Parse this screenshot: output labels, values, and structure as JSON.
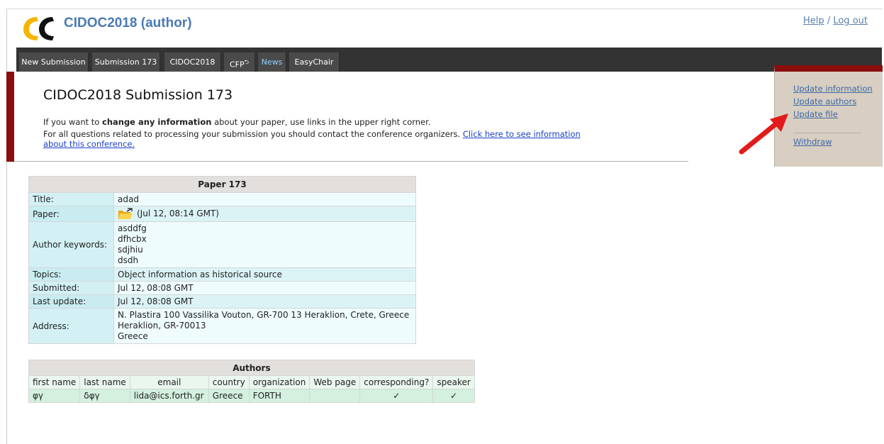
{
  "header": {
    "app_title": "CIDOC2018 (author)",
    "help_link": "Help",
    "separator": "/",
    "logout_link": "Log out"
  },
  "nav": {
    "tabs": [
      "New Submission",
      "Submission 173",
      "CIDOC2018",
      "CFP",
      "News",
      "EasyChair"
    ]
  },
  "main": {
    "heading": "CIDOC2018 Submission 173",
    "info1_pre": "If you want to ",
    "info1_bold": "change any information",
    "info1_post": " about your paper, use links in the upper right corner.",
    "info2_pre": "For all questions related to processing your submission you should contact the conference organizers. ",
    "info2_link_line1": "Click here to see information",
    "info2_link_line2": "about this conference."
  },
  "side_panel": {
    "update_information": "Update information",
    "update_authors": "Update authors",
    "update_file": "Update file",
    "withdraw": "Withdraw"
  },
  "paper": {
    "caption": "Paper 173",
    "rows": {
      "title_label": "Title:",
      "title_value": "adad",
      "paper_label": "Paper:",
      "paper_value": "(Jul 12, 08:14 GMT)",
      "keywords_label": "Author keywords:",
      "keywords": [
        "asddfg",
        "dfhcbx",
        "sdjhiu",
        "dsdh"
      ],
      "topics_label": "Topics:",
      "topics_value": "Object information as historical source",
      "submitted_label": "Submitted:",
      "submitted_value": "Jul 12, 08:08 GMT",
      "last_update_label": "Last update:",
      "last_update_value": "Jul 12, 08:08 GMT",
      "address_label": "Address:",
      "address_lines": [
        "N. Plastira 100 Vassilika Vouton, GR-700 13 Heraklion, Crete, Greece",
        "Heraklion, GR-70013",
        "Greece"
      ]
    }
  },
  "authors": {
    "caption": "Authors",
    "columns": [
      "first name",
      "last name",
      "email",
      "country",
      "organization",
      "Web page",
      "corresponding?",
      "speaker"
    ],
    "row": {
      "first_name": "φγ",
      "last_name": "δφγ",
      "email": "lida@ics.forth.gr",
      "country": "Greece",
      "organization": "FORTH",
      "web_page": "",
      "corresponding": "✓",
      "speaker": "✓"
    }
  },
  "colors": {
    "accent_red": "#8a0e0e",
    "nav_bg": "#333333",
    "link_blue": "#1a3fc8"
  },
  "icons": [
    "easychair-logo",
    "folder-icon",
    "red-arrow"
  ]
}
